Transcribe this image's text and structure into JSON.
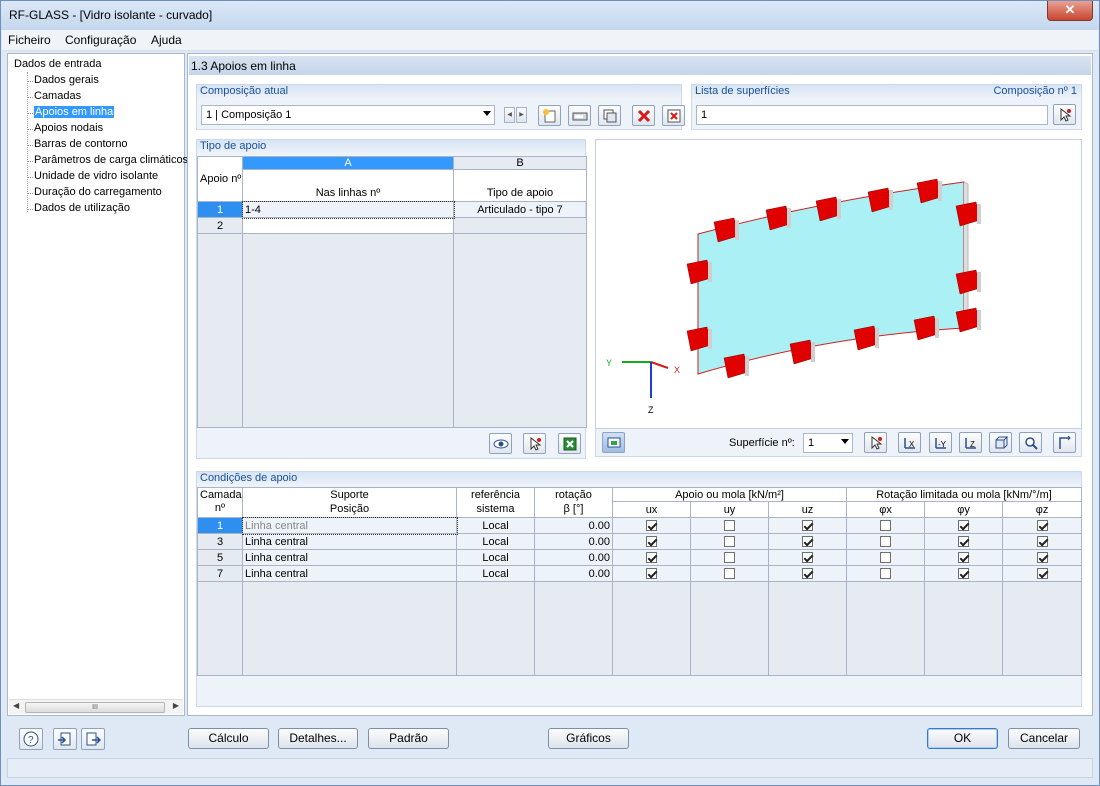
{
  "window": {
    "title": "RF-GLASS - [Vidro isolante - curvado]",
    "close": "✕"
  },
  "menu": [
    "Ficheiro",
    "Configuração",
    "Ajuda"
  ],
  "nav": {
    "root": "Dados de entrada",
    "items": [
      {
        "label": "Dados gerais",
        "selected": false
      },
      {
        "label": "Camadas",
        "selected": false
      },
      {
        "label": "Apoios em linha",
        "selected": true
      },
      {
        "label": "Apoios nodais",
        "selected": false
      },
      {
        "label": "Barras de contorno",
        "selected": false
      },
      {
        "label": "Parâmetros de carga climáticos",
        "selected": false
      },
      {
        "label": "Unidade de vidro isolante",
        "selected": false
      },
      {
        "label": "Duração do carregamento",
        "selected": false
      },
      {
        "label": "Dados de utilização",
        "selected": false
      }
    ],
    "scroll_thumb": "III"
  },
  "section_title": "1.3 Apoios em linha",
  "composition": {
    "label": "Composição atual",
    "value": "1 | Composição 1"
  },
  "surfaces": {
    "label": "Lista de superfícies",
    "comp_label": "Composição nº 1",
    "value": "1"
  },
  "support_type": {
    "label": "Tipo de apoio",
    "col_a": "A",
    "col_b": "B",
    "hdr_num": "Apoio nº",
    "hdr_lines": "Nas linhas nº",
    "hdr_type": "Tipo de apoio",
    "rows": [
      {
        "num": "1",
        "lines": "1-4",
        "type": "Articulado - tipo 7"
      },
      {
        "num": "2",
        "lines": "",
        "type": ""
      }
    ]
  },
  "viewer": {
    "axis_x": "X",
    "axis_y": "Y",
    "axis_z": "Z",
    "surface_label": "Superfície nº:",
    "surface_value": "1",
    "colors": {
      "glass": "#aaf0f5",
      "support": "#e00000",
      "edge": "#d02020"
    }
  },
  "conditions": {
    "label": "Condições de apoio",
    "headers": {
      "layer": "Camada",
      "layer_num": "nº",
      "support": "Suporte",
      "position": "Posição",
      "ref": "referência",
      "ref2": "sistema",
      "rot": "rotação",
      "rot2": "β [°]",
      "spring": "Apoio ou mola [kN/m²]",
      "rot_spring": "Rotação limitada ou mola [kNm/°/m]",
      "ux": "ux",
      "uy": "uy",
      "uz": "uz",
      "px": "φx",
      "py": "φy",
      "pz": "φz"
    },
    "rows": [
      {
        "layer": "1",
        "position": "Linha central",
        "ref": "Local",
        "rot": "0.00",
        "ux": true,
        "uy": false,
        "uz": true,
        "px": false,
        "py": true,
        "pz": true
      },
      {
        "layer": "3",
        "position": "Linha central",
        "ref": "Local",
        "rot": "0.00",
        "ux": true,
        "uy": false,
        "uz": true,
        "px": false,
        "py": true,
        "pz": true
      },
      {
        "layer": "5",
        "position": "Linha central",
        "ref": "Local",
        "rot": "0.00",
        "ux": true,
        "uy": false,
        "uz": true,
        "px": false,
        "py": true,
        "pz": true
      },
      {
        "layer": "7",
        "position": "Linha central",
        "ref": "Local",
        "rot": "0.00",
        "ux": true,
        "uy": false,
        "uz": true,
        "px": false,
        "py": true,
        "pz": true
      }
    ]
  },
  "buttons": {
    "calc": "Cálculo",
    "details": "Detalhes...",
    "default": "Padrão",
    "graphics": "Gráficos",
    "ok": "OK",
    "cancel": "Cancelar"
  }
}
